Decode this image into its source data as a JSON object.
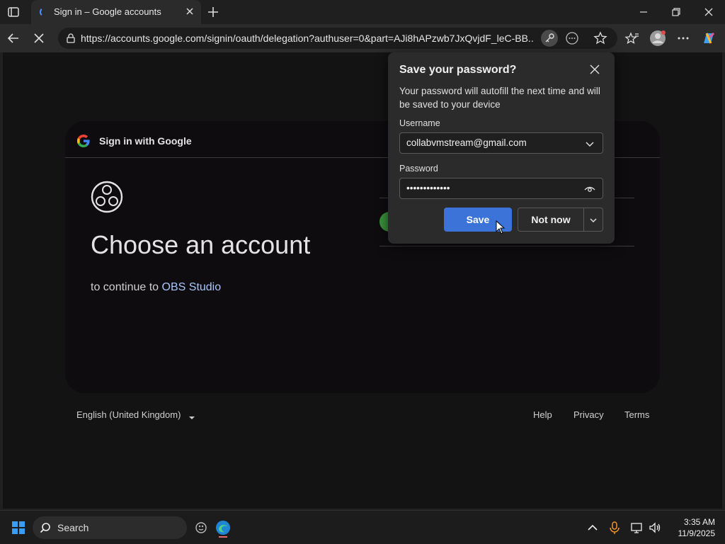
{
  "browser": {
    "tab_title": "Sign in – Google accounts",
    "url": "https://accounts.google.com/signin/oauth/delegation?authuser=0&part=AJi8hAPzwb7JxQvjdF_leC-BB..."
  },
  "page": {
    "header_text": "Sign in with Google",
    "heading": "Choose an account",
    "continue_prefix": "to continue to",
    "app_name": "OBS Studio",
    "language": "English (United Kingdom)",
    "footer_links": [
      "Help",
      "Privacy",
      "Terms"
    ]
  },
  "popup": {
    "title": "Save your password?",
    "description": "Your password will autofill the next time and will be saved to your device",
    "username_label": "Username",
    "username_value": "collabvmstream@gmail.com",
    "password_label": "Password",
    "password_value": "•••••••••••••",
    "save_label": "Save",
    "not_now_label": "Not now"
  },
  "taskbar": {
    "search_placeholder": "Search",
    "time": "3:35 AM",
    "date": "11/9/2025"
  },
  "colors": {
    "accent": "#3b73d9",
    "link": "#a8c7fa"
  }
}
